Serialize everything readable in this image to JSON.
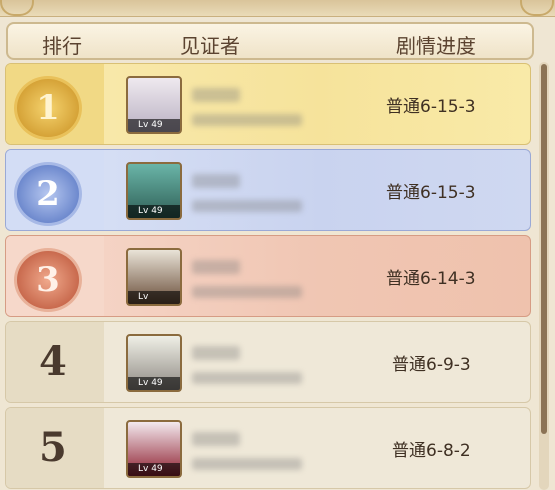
{
  "header": {
    "col_rank": "排行",
    "col_witness": "见证者",
    "col_progress": "剧情进度"
  },
  "rows": [
    {
      "rank": "1",
      "level": "Lv 49",
      "progress": "普通6-15-3"
    },
    {
      "rank": "2",
      "level": "Lv 49",
      "progress": "普通6-15-3"
    },
    {
      "rank": "3",
      "level": "Lv",
      "progress": "普通6-14-3"
    },
    {
      "rank": "4",
      "level": "Lv 49",
      "progress": "普通6-9-3"
    },
    {
      "rank": "5",
      "level": "Lv 49",
      "progress": "普通6-8-2"
    }
  ],
  "colors": {
    "gold": "#f7e59a",
    "silver": "#c9d4ef",
    "bronze": "#f2c9b5",
    "plain": "#ede4d0"
  }
}
